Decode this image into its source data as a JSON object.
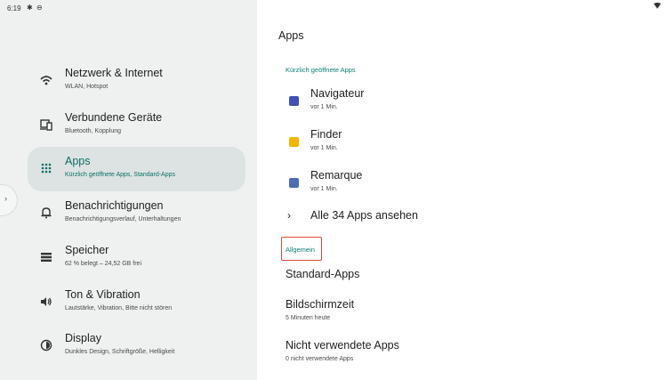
{
  "status_bar": {
    "time": "6:19"
  },
  "sidebar": {
    "items": [
      {
        "label": "Netzwerk & Internet",
        "sublabel": "WLAN, Hotspot",
        "icon": "wifi-icon"
      },
      {
        "label": "Verbundene Geräte",
        "sublabel": "Bluetooth, Kopplung",
        "icon": "devices-icon"
      },
      {
        "label": "Apps",
        "sublabel": "Kürzlich geöffnete Apps, Standard-Apps",
        "icon": "apps-grid-icon"
      },
      {
        "label": "Benachrichtigungen",
        "sublabel": "Benachrichtigungsverlauf, Unterhaltungen",
        "icon": "bell-icon"
      },
      {
        "label": "Speicher",
        "sublabel": "62 % belegt – 24,52 GB frei",
        "icon": "storage-icon"
      },
      {
        "label": "Ton & Vibration",
        "sublabel": "Lautstärke, Vibration, Bitte nicht stören",
        "icon": "volume-icon"
      },
      {
        "label": "Display",
        "sublabel": "Dunkles Design, Schriftgröße, Helligkeit",
        "icon": "brightness-icon"
      }
    ],
    "active_index": 2
  },
  "main": {
    "title": "Apps",
    "recent_header": "Kürzlich geöffnete Apps",
    "recent_apps": [
      {
        "name": "Navigateur",
        "time": "vor 1 Min.",
        "icon": "browser-app-icon",
        "color": "#3f51b5"
      },
      {
        "name": "Finder",
        "time": "vor 1 Min.",
        "icon": "folder-app-icon",
        "color": "#f4b400"
      },
      {
        "name": "Remarque",
        "time": "vor 1 Min.",
        "icon": "notes-app-icon",
        "color": "#4a6fb5"
      }
    ],
    "see_all": "Alle 34 Apps ansehen",
    "general_header": "Allgemein",
    "settings": [
      {
        "title": "Standard-Apps",
        "sub": ""
      },
      {
        "title": "Bildschirmzeit",
        "sub": "5 Minuten heute"
      },
      {
        "title": "Nicht verwendete Apps",
        "sub": "0 nicht verwendete Apps"
      }
    ]
  },
  "colors": {
    "accent": "#0b7d73",
    "sidebar_bg": "#eef1f0",
    "active_bg": "#dde3e2",
    "highlight": "#e0483c"
  }
}
